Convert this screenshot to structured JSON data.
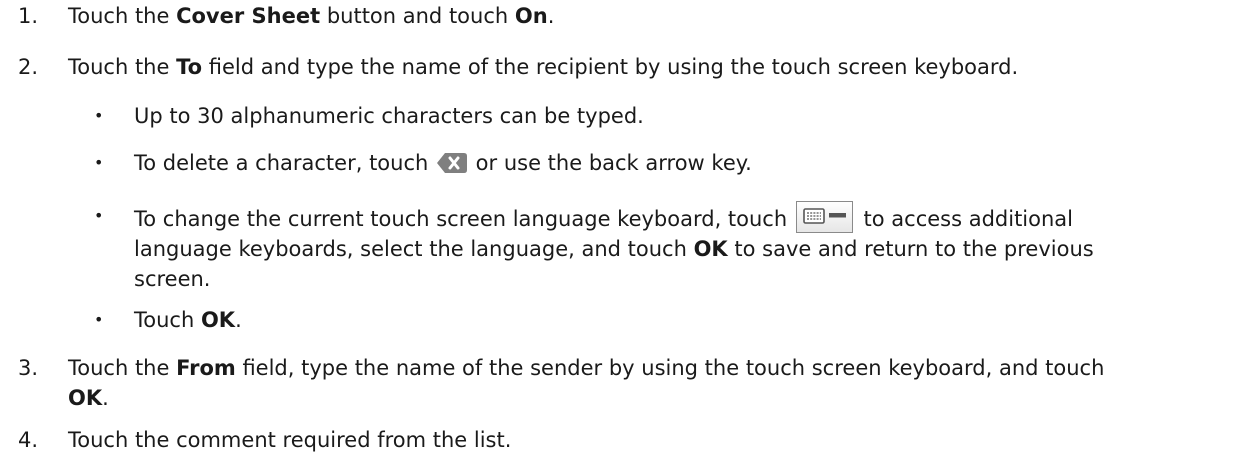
{
  "steps": [
    {
      "num": "1.",
      "pre": "Touch the ",
      "b1": "Cover Sheet",
      "mid": " button and touch ",
      "b2": "On",
      "post": "."
    },
    {
      "num": "2.",
      "pre": "Touch the ",
      "b1": "To",
      "post": " field and type the name of the recipient by using the touch screen keyboard."
    },
    {
      "num": "3.",
      "pre": "Touch the ",
      "b1": "From",
      "post": " field, type the name of the sender by using the touch screen keyboard, and touch",
      "line2_b": "OK",
      "line2_post": "."
    },
    {
      "num": "4.",
      "text": "Touch the comment required from the list."
    }
  ],
  "bullets": [
    {
      "text": "Up to 30 alphanumeric characters can be typed."
    },
    {
      "pre": "To delete a character, touch ",
      "icon": "delete-backspace-icon",
      "post": " or use the back arrow key."
    },
    {
      "pre": "To change the current touch screen language keyboard, touch ",
      "icon": "keyboard-language-icon",
      "post": " to access additional",
      "line2_pre": "language keyboards, select the language, and touch ",
      "line2_b": "OK",
      "line2_post": " to save and return to the previous",
      "line3": "screen."
    },
    {
      "pre": "Touch ",
      "b": "OK",
      "post": "."
    }
  ],
  "bullet_char": "•"
}
